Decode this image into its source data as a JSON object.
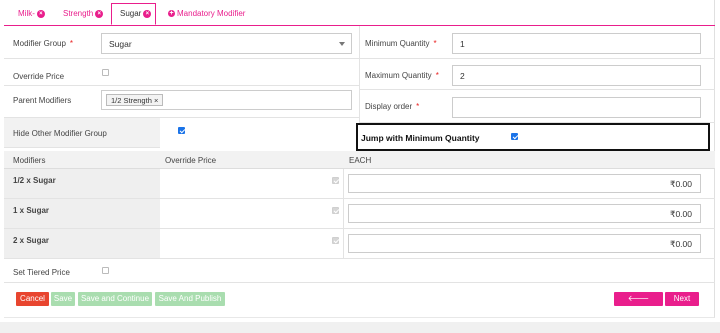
{
  "tabs": [
    {
      "label": "Milk-",
      "closable": true
    },
    {
      "label": "Strength",
      "closable": true
    },
    {
      "label": "Sugar",
      "closable": true,
      "active": true
    },
    {
      "label": "Mandatory Modifier",
      "addable": true
    }
  ],
  "form": {
    "modifier_group_label": "Modifier Group",
    "modifier_group_value": "Sugar",
    "override_price_label": "Override Price",
    "parent_modifiers_label": "Parent Modifiers",
    "parent_modifier_chip": "1/2 Strength",
    "min_qty_label": "Minimum Quantity",
    "min_qty_value": "1",
    "max_qty_label": "Maximum Quantity",
    "max_qty_value": "2",
    "display_order_label": "Display order",
    "display_order_value": "",
    "required_mark": "*",
    "hide_other_label": "Hide Other Modifier Group",
    "jump_min_label": "Jump with Minimum Quantity",
    "set_tiered_label": "Set Tiered Price"
  },
  "table": {
    "headers": [
      "Modifiers",
      "Override Price",
      "EACH"
    ],
    "rows": [
      {
        "name": "1/2 x Sugar",
        "price": "₹0.00"
      },
      {
        "name": "1 x Sugar",
        "price": "₹0.00"
      },
      {
        "name": "2 x Sugar",
        "price": "₹0.00"
      }
    ]
  },
  "buttons": {
    "cancel": "Cancel",
    "save": "Save",
    "save_continue": "Save and Continue",
    "save_publish": "Save And Publish",
    "previous": "Previous",
    "next": "Next"
  },
  "colors": {
    "accent": "#e91e8c",
    "cancel": "#e8452f",
    "disabled_green": "#a9ddaf",
    "checkbox_blue": "#1a73e8"
  }
}
